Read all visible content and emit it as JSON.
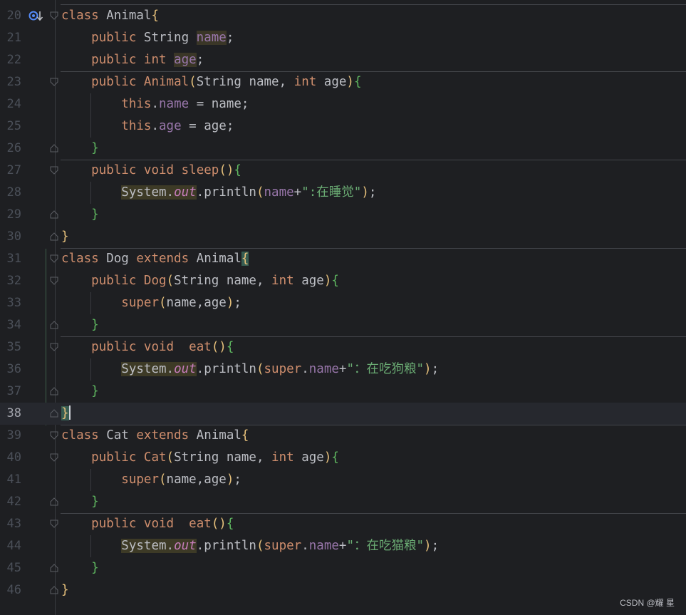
{
  "editor": {
    "lines": [
      {
        "n": "20",
        "segments": [
          [
            "kw",
            "class"
          ],
          [
            "plain",
            " Animal"
          ],
          [
            "brace",
            "{"
          ]
        ]
      },
      {
        "n": "21",
        "segments": [
          [
            "plain",
            "    "
          ],
          [
            "kw",
            "public"
          ],
          [
            "plain",
            " String "
          ],
          [
            "field hl",
            "name"
          ],
          [
            "plain",
            ";"
          ]
        ]
      },
      {
        "n": "22",
        "segments": [
          [
            "plain",
            "    "
          ],
          [
            "kw",
            "public"
          ],
          [
            "plain",
            " "
          ],
          [
            "kw",
            "int"
          ],
          [
            "plain",
            " "
          ],
          [
            "field hl",
            "age"
          ],
          [
            "plain",
            ";"
          ]
        ]
      },
      {
        "n": "23",
        "segments": [
          [
            "plain",
            "    "
          ],
          [
            "kw",
            "public"
          ],
          [
            "plain",
            " "
          ],
          [
            "kw",
            "Animal"
          ],
          [
            "paren",
            "("
          ],
          [
            "plain",
            "String name, "
          ],
          [
            "kw",
            "int"
          ],
          [
            "plain",
            " age"
          ],
          [
            "paren",
            ")"
          ],
          [
            "brace-green",
            "{"
          ]
        ]
      },
      {
        "n": "24",
        "segments": [
          [
            "plain",
            "        "
          ],
          [
            "kw",
            "this"
          ],
          [
            "plain",
            "."
          ],
          [
            "name-field",
            "name"
          ],
          [
            "plain",
            " = name;"
          ]
        ]
      },
      {
        "n": "25",
        "segments": [
          [
            "plain",
            "        "
          ],
          [
            "kw",
            "this"
          ],
          [
            "plain",
            "."
          ],
          [
            "name-field",
            "age"
          ],
          [
            "plain",
            " = age;"
          ]
        ]
      },
      {
        "n": "26",
        "segments": [
          [
            "plain",
            "    "
          ],
          [
            "brace-green",
            "}"
          ]
        ]
      },
      {
        "n": "27",
        "segments": [
          [
            "plain",
            "    "
          ],
          [
            "kw",
            "public"
          ],
          [
            "plain",
            " "
          ],
          [
            "kw",
            "void"
          ],
          [
            "plain",
            " "
          ],
          [
            "kw",
            "sleep"
          ],
          [
            "paren",
            "()"
          ],
          [
            "brace-green",
            "{"
          ]
        ]
      },
      {
        "n": "28",
        "segments": [
          [
            "plain",
            "        "
          ],
          [
            "ident hl",
            "System."
          ],
          [
            "static hl",
            "out"
          ],
          [
            "plain",
            ".println"
          ],
          [
            "paren",
            "("
          ],
          [
            "name-field",
            "name"
          ],
          [
            "plain",
            "+"
          ],
          [
            "str",
            "\":在睡觉\""
          ],
          [
            "paren",
            ")"
          ],
          [
            "plain",
            ";"
          ]
        ]
      },
      {
        "n": "29",
        "segments": [
          [
            "plain",
            "    "
          ],
          [
            "brace-green",
            "}"
          ]
        ]
      },
      {
        "n": "30",
        "segments": [
          [
            "brace",
            "}"
          ]
        ]
      },
      {
        "n": "31",
        "segments": [
          [
            "kw",
            "class"
          ],
          [
            "plain",
            " Dog "
          ],
          [
            "kw",
            "extends"
          ],
          [
            "plain",
            " Animal"
          ],
          [
            "brace match",
            "{"
          ]
        ]
      },
      {
        "n": "32",
        "segments": [
          [
            "plain",
            "    "
          ],
          [
            "kw",
            "public"
          ],
          [
            "plain",
            " "
          ],
          [
            "kw",
            "Dog"
          ],
          [
            "paren",
            "("
          ],
          [
            "plain",
            "String name, "
          ],
          [
            "kw",
            "int"
          ],
          [
            "plain",
            " age"
          ],
          [
            "paren",
            ")"
          ],
          [
            "brace-green",
            "{"
          ]
        ]
      },
      {
        "n": "33",
        "segments": [
          [
            "plain",
            "        "
          ],
          [
            "kw",
            "super"
          ],
          [
            "paren",
            "("
          ],
          [
            "plain",
            "name,age"
          ],
          [
            "paren",
            ")"
          ],
          [
            "plain",
            ";"
          ]
        ]
      },
      {
        "n": "34",
        "segments": [
          [
            "plain",
            "    "
          ],
          [
            "brace-green",
            "}"
          ]
        ]
      },
      {
        "n": "35",
        "segments": [
          [
            "plain",
            "    "
          ],
          [
            "kw",
            "public"
          ],
          [
            "plain",
            " "
          ],
          [
            "kw",
            "void"
          ],
          [
            "plain",
            "  "
          ],
          [
            "kw",
            "eat"
          ],
          [
            "paren",
            "()"
          ],
          [
            "brace-green",
            "{"
          ]
        ]
      },
      {
        "n": "36",
        "segments": [
          [
            "plain",
            "        "
          ],
          [
            "ident hl",
            "System."
          ],
          [
            "static hl",
            "out"
          ],
          [
            "plain",
            ".println"
          ],
          [
            "paren",
            "("
          ],
          [
            "kw",
            "super"
          ],
          [
            "plain",
            "."
          ],
          [
            "name-field",
            "name"
          ],
          [
            "plain",
            "+"
          ],
          [
            "str",
            "\"：在吃狗粮\""
          ],
          [
            "paren",
            ")"
          ],
          [
            "plain",
            ";"
          ]
        ]
      },
      {
        "n": "37",
        "segments": [
          [
            "plain",
            "    "
          ],
          [
            "brace-green",
            "}"
          ]
        ]
      },
      {
        "n": "38",
        "segments": [
          [
            "brace match",
            "}"
          ],
          [
            "caret",
            ""
          ]
        ]
      },
      {
        "n": "39",
        "segments": [
          [
            "kw",
            "class"
          ],
          [
            "plain",
            " Cat "
          ],
          [
            "kw",
            "extends"
          ],
          [
            "plain",
            " Animal"
          ],
          [
            "brace",
            "{"
          ]
        ]
      },
      {
        "n": "40",
        "segments": [
          [
            "plain",
            "    "
          ],
          [
            "kw",
            "public"
          ],
          [
            "plain",
            " "
          ],
          [
            "kw",
            "Cat"
          ],
          [
            "paren",
            "("
          ],
          [
            "plain",
            "String name, "
          ],
          [
            "kw",
            "int"
          ],
          [
            "plain",
            " age"
          ],
          [
            "paren",
            ")"
          ],
          [
            "brace-green",
            "{"
          ]
        ]
      },
      {
        "n": "41",
        "segments": [
          [
            "plain",
            "        "
          ],
          [
            "kw",
            "super"
          ],
          [
            "paren",
            "("
          ],
          [
            "plain",
            "name,age"
          ],
          [
            "paren",
            ")"
          ],
          [
            "plain",
            ";"
          ]
        ]
      },
      {
        "n": "42",
        "segments": [
          [
            "plain",
            "    "
          ],
          [
            "brace-green",
            "}"
          ]
        ]
      },
      {
        "n": "43",
        "segments": [
          [
            "plain",
            "    "
          ],
          [
            "kw",
            "public"
          ],
          [
            "plain",
            " "
          ],
          [
            "kw",
            "void"
          ],
          [
            "plain",
            "  "
          ],
          [
            "kw",
            "eat"
          ],
          [
            "paren",
            "()"
          ],
          [
            "brace-green",
            "{"
          ]
        ]
      },
      {
        "n": "44",
        "segments": [
          [
            "plain",
            "        "
          ],
          [
            "ident hl",
            "System."
          ],
          [
            "static hl",
            "out"
          ],
          [
            "plain",
            ".println"
          ],
          [
            "paren",
            "("
          ],
          [
            "kw",
            "super"
          ],
          [
            "plain",
            "."
          ],
          [
            "name-field",
            "name"
          ],
          [
            "plain",
            "+"
          ],
          [
            "str",
            "\"：在吃猫粮\""
          ],
          [
            "paren",
            ")"
          ],
          [
            "plain",
            ";"
          ]
        ]
      },
      {
        "n": "45",
        "segments": [
          [
            "plain",
            "    "
          ],
          [
            "brace-green",
            "}"
          ]
        ]
      },
      {
        "n": "46",
        "segments": [
          [
            "brace",
            "}"
          ]
        ]
      }
    ],
    "current_line": "38",
    "override_icon": "override-implemented-icon"
  },
  "colors": {
    "background": "#1e1f22",
    "keyword": "#cf8e6d",
    "string": "#6aab73",
    "field": "#9876aa",
    "brace": "#e6c07b",
    "brace_green": "#5fb760",
    "text": "#bcbec4"
  },
  "watermark": "CSDN @耀 星"
}
